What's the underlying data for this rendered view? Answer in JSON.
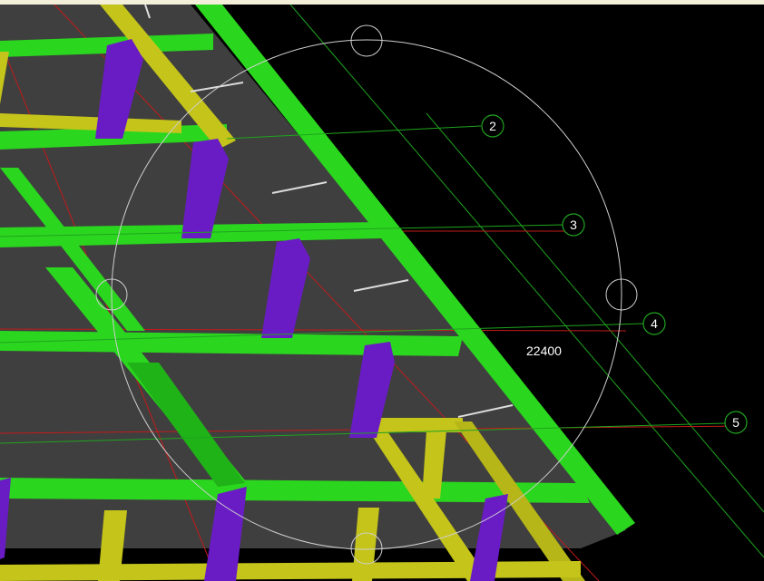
{
  "viewport": {
    "background": "#000000",
    "title_strip_color": "#f3efd9",
    "colors": {
      "roof_panel": "#3f3f3f",
      "primary_beam": "#2bd61f",
      "secondary_beam": "#c4c41a",
      "column": "#6a1cc4",
      "gridline_green": "#1fa41f",
      "gridline_red": "#c41a1a",
      "circle": "#cfcfcf",
      "arrow": "#dcdcdc"
    },
    "grid_bubbles": [
      {
        "label": "2"
      },
      {
        "label": "3"
      },
      {
        "label": "4"
      },
      {
        "label": "5"
      }
    ],
    "dimension": {
      "text": "22400"
    },
    "circle_markers": [
      {
        "name": "top"
      },
      {
        "name": "left"
      },
      {
        "name": "right"
      },
      {
        "name": "bottom"
      }
    ]
  }
}
